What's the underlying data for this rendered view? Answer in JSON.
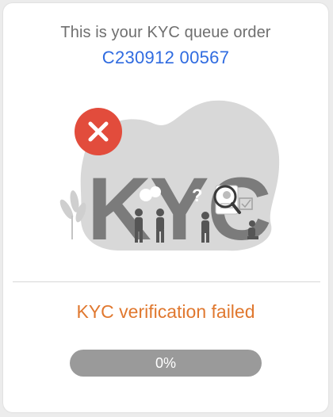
{
  "header": {
    "queue_title": "This is your KYC queue order",
    "queue_number": "C230912 00567"
  },
  "illustration": {
    "icon": "error-x-icon",
    "logo_text": "KYC",
    "status_color": "#e24c3c"
  },
  "status": {
    "message": "KYC verification failed",
    "color": "#e0782f"
  },
  "progress": {
    "label": "0%",
    "value": 0
  },
  "colors": {
    "accent": "#2f6be0",
    "track": "#9a9a9a"
  }
}
